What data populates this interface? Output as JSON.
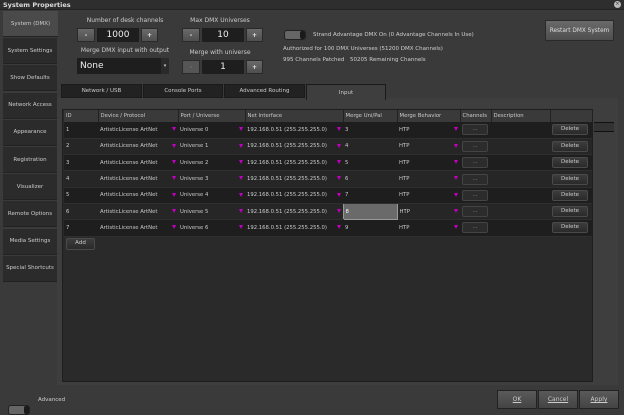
{
  "window": {
    "title": "System Properties"
  },
  "sidebar": {
    "items": [
      {
        "label": "System (DMX)"
      },
      {
        "label": "System Settings"
      },
      {
        "label": "Show Defaults"
      },
      {
        "label": "Network Access"
      },
      {
        "label": "Appearance"
      },
      {
        "label": "Registration"
      },
      {
        "label": "Visualizer"
      },
      {
        "label": "Remote Options"
      },
      {
        "label": "Media  Settings"
      },
      {
        "label": "Special Shortcuts"
      }
    ]
  },
  "settings": {
    "desk_channels_label": "Number of desk channels",
    "desk_channels": "1000",
    "max_universes_label": "Max DMX Universes",
    "max_universes": "10",
    "merge_input_label": "Merge DMX input with output",
    "merge_input": "None",
    "merge_universe_label": "Merge with universe",
    "merge_universe": "1",
    "minus": "-",
    "plus": "+",
    "advantage_label": "Strand Advantage DMX On (0 Advantage Channels In Use)",
    "authorized": "Authorized for  100 DMX Universes (51200 DMX Channels)",
    "patched": "995 Channels Patched",
    "remaining": "50205 Remaining Channels",
    "restart_label": "Restart DMX System"
  },
  "tabs": [
    {
      "label": "Network / USB"
    },
    {
      "label": "Console Ports"
    },
    {
      "label": "Advanced Routing"
    },
    {
      "label": "Input"
    }
  ],
  "table": {
    "headers": [
      "ID",
      "Device / Protocol",
      "Port / Universe",
      "Net Interface",
      "Merge Uni/Pal",
      "Merge Behavior",
      "Channels",
      "Description",
      ""
    ],
    "rows": [
      {
        "id": "1",
        "device": "ArtisticLicense ArtNet",
        "port": "Universe 0",
        "net": "192.168.0.51 (255.255.255.0)",
        "merge": "3",
        "behavior": "HTP",
        "channels": "...",
        "desc": "",
        "delete": "Delete"
      },
      {
        "id": "2",
        "device": "ArtisticLicense ArtNet",
        "port": "Universe 1",
        "net": "192.168.0.51 (255.255.255.0)",
        "merge": "4",
        "behavior": "HTP",
        "channels": "...",
        "desc": "",
        "delete": "Delete"
      },
      {
        "id": "3",
        "device": "ArtisticLicense ArtNet",
        "port": "Universe 2",
        "net": "192.168.0.51 (255.255.255.0)",
        "merge": "5",
        "behavior": "HTP",
        "channels": "...",
        "desc": "",
        "delete": "Delete"
      },
      {
        "id": "4",
        "device": "ArtisticLicense ArtNet",
        "port": "Universe 3",
        "net": "192.168.0.51 (255.255.255.0)",
        "merge": "6",
        "behavior": "HTP",
        "channels": "...",
        "desc": "",
        "delete": "Delete"
      },
      {
        "id": "5",
        "device": "ArtisticLicense ArtNet",
        "port": "Universe 4",
        "net": "192.168.0.51 (255.255.255.0)",
        "merge": "7",
        "behavior": "HTP",
        "channels": "...",
        "desc": "",
        "delete": "Delete"
      },
      {
        "id": "6",
        "device": "ArtisticLicense ArtNet",
        "port": "Universe 5",
        "net": "192.168.0.51 (255.255.255.0)",
        "merge": "8",
        "behavior": "HTP",
        "channels": "...",
        "desc": "",
        "delete": "Delete"
      },
      {
        "id": "7",
        "device": "ArtisticLicense ArtNet",
        "port": "Universe 6",
        "net": "192.168.0.51 (255.255.255.0)",
        "merge": "9",
        "behavior": "HTP",
        "channels": "...",
        "desc": "",
        "delete": "Delete"
      }
    ],
    "add_label": "Add"
  },
  "footer": {
    "advanced_label": "Advanced",
    "ok": "OK",
    "cancel": "Cancel",
    "apply": "Apply"
  }
}
